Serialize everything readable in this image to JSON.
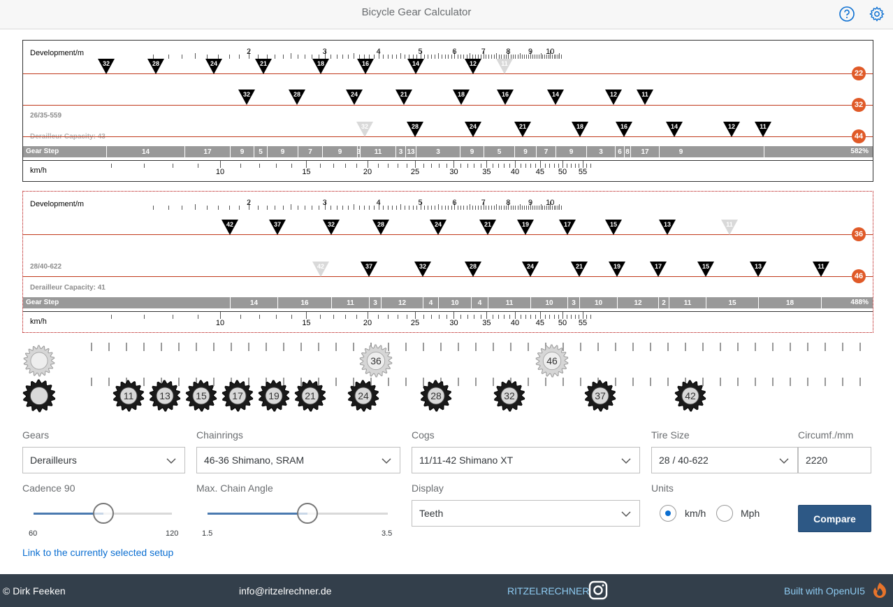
{
  "header": {
    "title": "Bicycle Gear Calculator",
    "help_icon": "question-circle-icon",
    "settings_icon": "gear-icon"
  },
  "dev_axis": {
    "label": "Development/m",
    "ticks": [
      "2",
      "3",
      "4",
      "5",
      "6",
      "7",
      "8",
      "9",
      "10"
    ]
  },
  "speed_axis": {
    "label": "km/h",
    "ticks": [
      "10",
      "15",
      "20",
      "25",
      "30",
      "35",
      "40",
      "45",
      "50",
      "55"
    ]
  },
  "panels": [
    {
      "size_label": "26/35-559",
      "capacity_label": "Derailleur Capacity: 43",
      "gear_step_label": "Gear Step",
      "gear_step_total": "582%",
      "rings": [
        {
          "teeth": "22",
          "cogs": [
            "32",
            "28",
            "24",
            "21",
            "18",
            "16",
            "14",
            "12",
            "11"
          ],
          "faded": [
            "11"
          ]
        },
        {
          "teeth": "32",
          "cogs": [
            "32",
            "28",
            "24",
            "21",
            "18",
            "16",
            "14",
            "12",
            "11"
          ],
          "faded": []
        },
        {
          "teeth": "44",
          "cogs": [
            "32",
            "28",
            "24",
            "21",
            "18",
            "16",
            "14",
            "12",
            "11"
          ],
          "faded": [
            "32"
          ]
        }
      ],
      "steps": [
        "14",
        "17",
        "9",
        "5",
        "9",
        "7",
        "9",
        "3",
        "11",
        "3",
        "13",
        "3",
        "9",
        "5",
        "9",
        "7",
        "9",
        "3",
        "6",
        "8",
        "17",
        "9"
      ]
    },
    {
      "size_label": "28/40-622",
      "capacity_label": "Derailleur Capacity: 41",
      "gear_step_label": "Gear Step",
      "gear_step_total": "488%",
      "rings": [
        {
          "teeth": "36",
          "cogs": [
            "42",
            "37",
            "32",
            "28",
            "24",
            "21",
            "19",
            "17",
            "15",
            "13",
            "11"
          ],
          "faded": [
            "11"
          ]
        },
        {
          "teeth": "46",
          "cogs": [
            "42",
            "37",
            "32",
            "28",
            "24",
            "21",
            "19",
            "17",
            "15",
            "13",
            "11"
          ],
          "faded": [
            "42"
          ]
        }
      ],
      "steps": [
        "14",
        "16",
        "11",
        "3",
        "12",
        "4",
        "10",
        "4",
        "11",
        "10",
        "3",
        "10",
        "12",
        "2",
        "11",
        "15",
        "18"
      ]
    }
  ],
  "chainrings_drawn": [
    "36",
    "46"
  ],
  "cogs_drawn": [
    "11",
    "13",
    "15",
    "17",
    "19",
    "21",
    "24",
    "28",
    "32",
    "37",
    "42"
  ],
  "form": {
    "gears": {
      "label": "Gears",
      "value": "Derailleurs"
    },
    "chainrings": {
      "label": "Chainrings",
      "value": "46-36 Shimano, SRAM"
    },
    "cogs": {
      "label": "Cogs",
      "value": "11/11-42 Shimano XT"
    },
    "tire": {
      "label": "Tire Size",
      "value": "28 / 40-622"
    },
    "circumference": {
      "label": "Circumf./mm",
      "value": "2220"
    },
    "cadence": {
      "label": "Cadence 90",
      "min": "60",
      "max": "120",
      "value": 90
    },
    "chain_angle": {
      "label": "Max. Chain Angle",
      "min": "1.5",
      "max": "3.5",
      "value": 2.5
    },
    "display": {
      "label": "Display",
      "value": "Teeth"
    },
    "units": {
      "label": "Units",
      "options": [
        "km/h",
        "Mph"
      ],
      "selected": "km/h"
    },
    "compare": "Compare",
    "link": "Link to the currently selected setup"
  },
  "footer": {
    "author": "© Dirk Feeken",
    "email": "info@ritzelrechner.de",
    "brand": "RITZELRECHNER",
    "built": "Built with OpenUI5"
  },
  "colors": {
    "accent": "#e05a28",
    "line": "#c0391b",
    "primary": "#2d5885",
    "footer": "#333f4b"
  }
}
